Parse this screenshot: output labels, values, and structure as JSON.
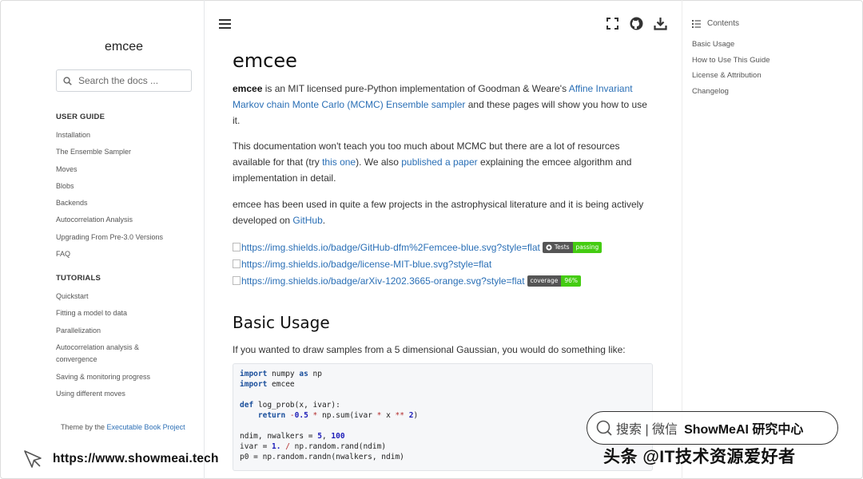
{
  "sidebar": {
    "title": "emcee",
    "search_placeholder": "Search the docs ...",
    "sections": [
      {
        "heading": "USER GUIDE",
        "items": [
          "Installation",
          "The Ensemble Sampler",
          "Moves",
          "Blobs",
          "Backends",
          "Autocorrelation Analysis",
          "Upgrading From Pre-3.0 Versions",
          "FAQ"
        ]
      },
      {
        "heading": "TUTORIALS",
        "items": [
          "Quickstart",
          "Fitting a model to data",
          "Parallelization",
          "Autocorrelation analysis & convergence",
          "Saving & monitoring progress",
          "Using different moves"
        ]
      }
    ],
    "theme_prefix": "Theme by the ",
    "theme_link": "Executable Book Project"
  },
  "topbar": {
    "icons": [
      "menu-icon",
      "fullscreen-icon",
      "github-icon",
      "download-icon"
    ]
  },
  "main": {
    "title": "emcee",
    "intro": {
      "bold": "emcee",
      "t1": " is an MIT licensed pure-Python implementation of Goodman & Weare's ",
      "link": "Affine Invariant Markov chain Monte Carlo (MCMC) Ensemble sampler",
      "t2": " and these pages will show you how to use it."
    },
    "para2": {
      "t1": "This documentation won't teach you too much about MCMC but there are a lot of resources available for that (try ",
      "link1": "this one",
      "t2": "). We also ",
      "link2": "published a paper",
      "t3": " explaining the emcee algorithm and implementation in detail."
    },
    "para3": {
      "t1": "emcee has been used in quite a few projects in the astrophysical literature and it is being actively developed on ",
      "link": "GitHub",
      "t2": "."
    },
    "badges": [
      {
        "url": "https://img.shields.io/badge/GitHub-dfm%2Femcee-blue.svg?style=flat",
        "label": "Tests",
        "value": "passing",
        "color": "#4c1"
      },
      {
        "url": "https://img.shields.io/badge/license-MIT-blue.svg?style=flat",
        "label": "",
        "value": "",
        "color": ""
      },
      {
        "url": "https://img.shields.io/badge/arXiv-1202.3665-orange.svg?style=flat",
        "label": "coverage",
        "value": "96%",
        "color": "#4c1"
      }
    ],
    "section_title": "Basic Usage",
    "section_text": "If you wanted to draw samples from a 5 dimensional Gaussian, you would do something like:",
    "code": {
      "l1a": "import",
      "l1b": " numpy ",
      "l1c": "as",
      "l1d": " np",
      "l2a": "import",
      "l2b": " emcee",
      "l4a": "def",
      "l4b": " log_prob(x, ivar):",
      "l5a": "    return",
      "l5b": " -",
      "l5c": "0.5",
      "l5d": " * ",
      "l5e": "np.sum(ivar ",
      "l5f": "*",
      "l5g": " x ",
      "l5h": "**",
      "l5i": " ",
      "l5j": "2",
      "l5k": ")",
      "l7a": "ndim, nwalkers = ",
      "l7b": "5",
      "l7c": ", ",
      "l7d": "100",
      "l8a": "ivar = ",
      "l8b": "1.",
      "l8c": " / ",
      "l8d": "np.random.rand(ndim)",
      "l9a": "p0 = np.random.randn(nwalkers, ndim)"
    }
  },
  "toc": {
    "title": "Contents",
    "items": [
      "Basic Usage",
      "How to Use This Guide",
      "License & Attribution",
      "Changelog"
    ]
  },
  "watermark": {
    "url": "https://www.showmeai.tech",
    "search_label": "搜索 | 微信",
    "brand": "ShowMeAI 研究中心",
    "sub": "头条 @IT技术资源爱好者"
  }
}
